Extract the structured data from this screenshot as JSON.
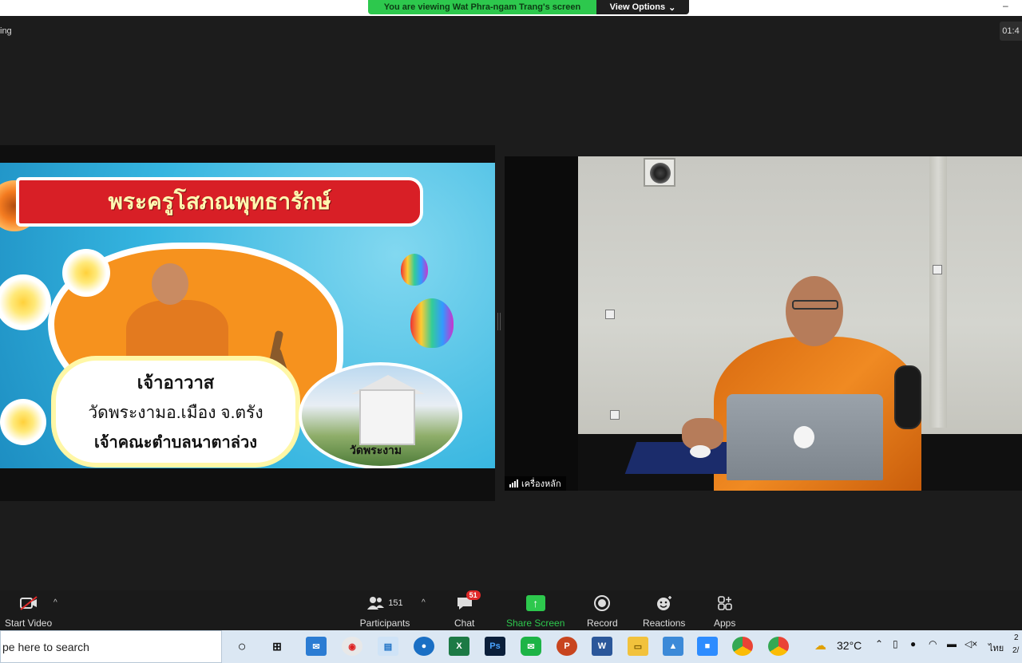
{
  "banner": {
    "viewing_text": "You are viewing Wat Phra-ngam Trang's screen",
    "view_options_label": "View Options",
    "view_options_caret": "⌄"
  },
  "window": {
    "title_fragment": "ing",
    "timer": "01:4",
    "minimize_glyph": "–"
  },
  "slide": {
    "banner_title": "พระครูโสภณพุทธารักษ์",
    "caption_line1": "เจ้าอาวาส",
    "caption_line2": "วัดพระงามอ.เมือง จ.ตรัง",
    "caption_line3": "เจ้าคณะตำบลนาตาล่วง",
    "photo_label": "วัดพระงาม"
  },
  "video": {
    "participant_name": "เครื่องหลัก"
  },
  "toolbar": {
    "start_video": "Start Video",
    "participants": "Participants",
    "participants_count": "151",
    "chat": "Chat",
    "chat_badge": "51",
    "share_screen": "Share Screen",
    "record": "Record",
    "reactions": "Reactions",
    "apps": "Apps",
    "caret": "^",
    "share_color": "#2dc84d"
  },
  "taskbar": {
    "search_placeholder": "pe here to search",
    "weather": "32°C",
    "language": "ไทย",
    "clock_a": "2",
    "clock_b": "2/"
  }
}
